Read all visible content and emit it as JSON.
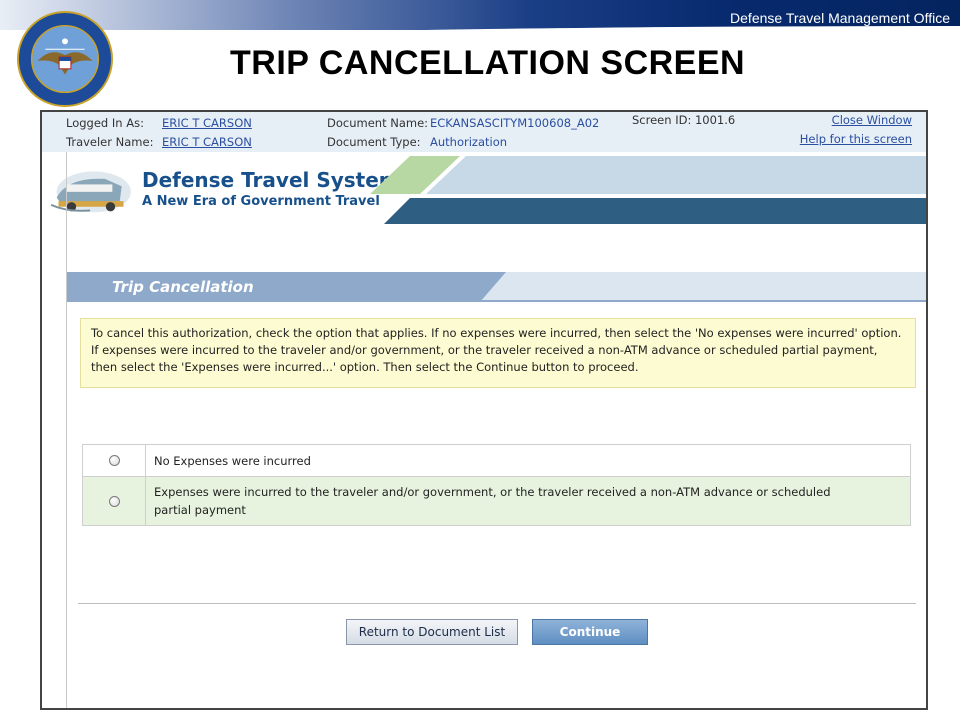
{
  "slide": {
    "org_label": "Defense Travel Management Office",
    "title": "TRIP CANCELLATION SCREEN"
  },
  "info_bar": {
    "logged_in_label": "Logged In As:",
    "logged_in_value": "ERIC T CARSON",
    "traveler_label": "Traveler Name:",
    "traveler_value": "ERIC T CARSON",
    "doc_name_label": "Document Name:",
    "doc_name_value": "ECKANSASCITYM100608_A02",
    "doc_type_label": "Document Type:",
    "doc_type_value": "Authorization",
    "screen_id": "Screen ID: 1001.6",
    "close_window": "Close Window",
    "help_link": "Help for this screen"
  },
  "banner": {
    "title": "Defense Travel System",
    "subtitle": "A New Era of Government Travel"
  },
  "section": {
    "title": "Trip Cancellation",
    "notice": "To cancel this authorization, check the option that applies. If no expenses were incurred, then select the 'No expenses were incurred' option. If expenses were incurred to the traveler and/or government, or the traveler received a non-ATM advance or scheduled partial payment, then select the 'Expenses were incurred...' option. Then select the Continue button to proceed."
  },
  "options": [
    {
      "label": "No Expenses were incurred",
      "selected": false
    },
    {
      "label": "Expenses were incurred to the traveler and/or government, or the traveler received a non-ATM advance or scheduled partial payment",
      "selected": false
    }
  ],
  "buttons": {
    "return_label": "Return to Document List",
    "continue_label": "Continue"
  },
  "colors": {
    "link": "#2b4fa0",
    "dts_blue": "#17508a",
    "section_header": "#8ea9c9",
    "notice_bg": "#fdfbd1",
    "option_highlight": "#e7f3df",
    "continue_button": "#6b99c9"
  },
  "icons": {
    "seal": "dod-seal-icon",
    "dts_logo": "dts-bus-logo-icon",
    "radio": "radio-button-icon"
  }
}
